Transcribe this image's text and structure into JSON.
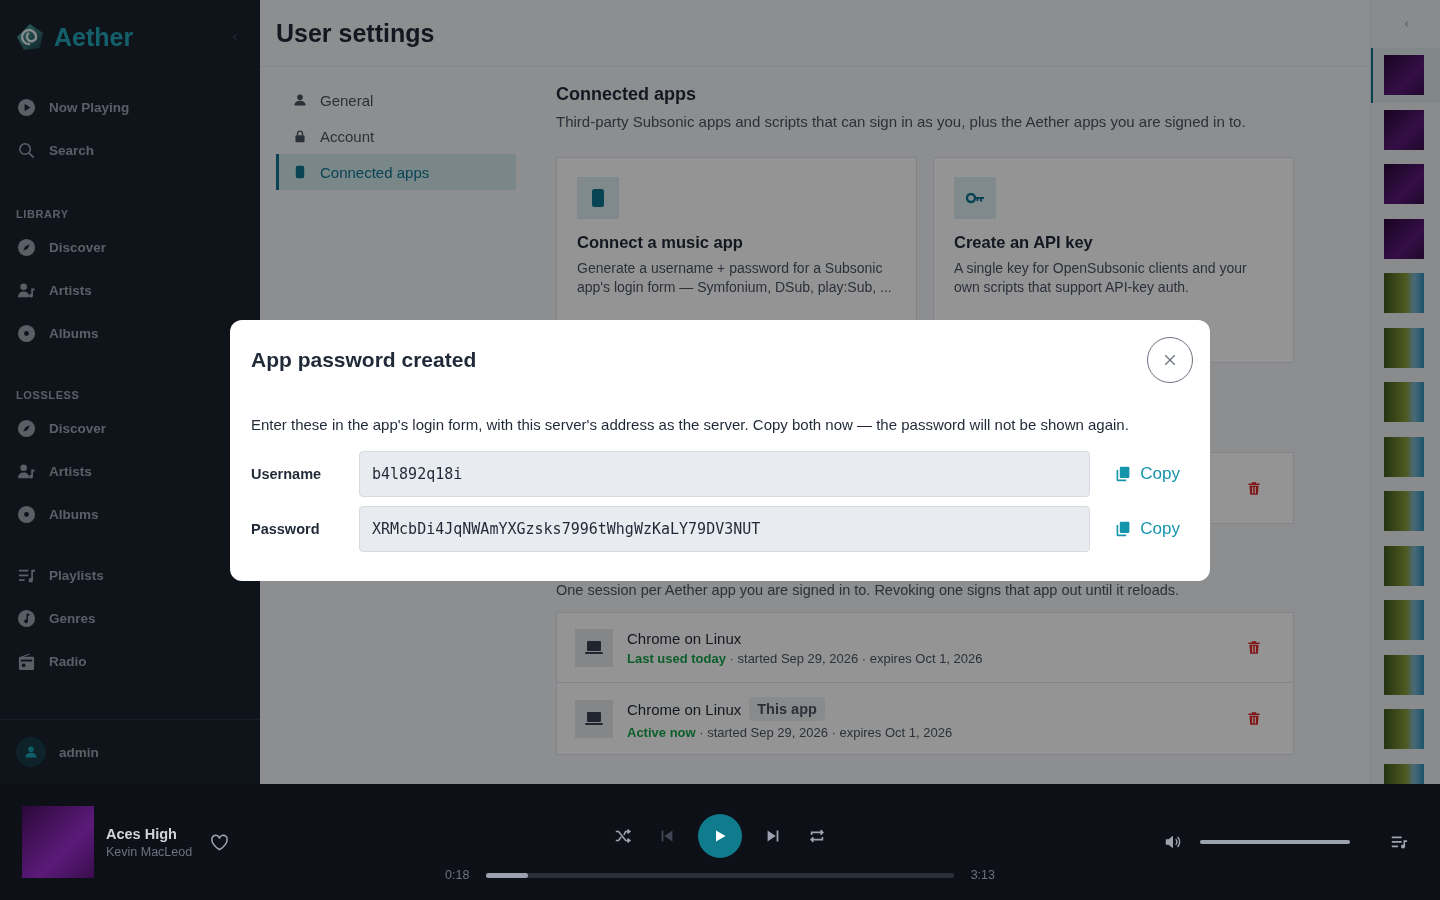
{
  "sidebar": {
    "brand": "Aether",
    "sections": [
      {
        "items": [
          {
            "label": "Now Playing"
          },
          {
            "label": "Search"
          }
        ]
      },
      {
        "heading": "LIBRARY",
        "items": [
          {
            "label": "Discover"
          },
          {
            "label": "Artists"
          },
          {
            "label": "Albums"
          }
        ]
      },
      {
        "heading": "LOSSLESS",
        "items": [
          {
            "label": "Discover"
          },
          {
            "label": "Artists"
          },
          {
            "label": "Albums"
          }
        ]
      },
      {
        "items": [
          {
            "label": "Playlists"
          },
          {
            "label": "Genres"
          },
          {
            "label": "Radio"
          }
        ]
      }
    ],
    "user": "admin"
  },
  "page": {
    "title": "User settings",
    "settings_nav": [
      {
        "label": "General",
        "selected": false
      },
      {
        "label": "Account",
        "selected": false
      },
      {
        "label": "Connected apps",
        "selected": true
      }
    ],
    "heading": "Connected apps",
    "description": "Third-party Subsonic apps and scripts that can sign in as you, plus the Aether apps you are signed in to.",
    "cards": [
      {
        "title": "Connect a music app",
        "description": "Generate a username + password for a Subsonic app's login form — Symfonium, DSub, play:Sub, ..."
      },
      {
        "title": "Create an API key",
        "description": "A single key for OpenSubsonic clients and your own scripts that support API-key auth."
      }
    ],
    "sessions_description": "One session per Aether app you are signed in to. Revoking one signs that app out until it reloads.",
    "sessions": [
      {
        "name": "Chrome on Linux",
        "status": "Last used today",
        "details": "· started Sep 29, 2026 · expires Oct 1, 2026"
      },
      {
        "name": "Chrome on Linux",
        "badge": "This app",
        "status": "Active now",
        "details": "· started Sep 29, 2026 · expires Oct 1, 2026"
      }
    ]
  },
  "queue": [
    {
      "kind": "funk",
      "selected": true
    },
    {
      "kind": "funk",
      "selected": false
    },
    {
      "kind": "funk",
      "selected": false
    },
    {
      "kind": "funk",
      "selected": false
    },
    {
      "kind": "nature",
      "selected": false
    },
    {
      "kind": "nature",
      "selected": false
    },
    {
      "kind": "nature",
      "selected": false
    },
    {
      "kind": "nature",
      "selected": false
    },
    {
      "kind": "nature",
      "selected": false
    },
    {
      "kind": "nature",
      "selected": false
    },
    {
      "kind": "nature",
      "selected": false
    },
    {
      "kind": "nature",
      "selected": false
    },
    {
      "kind": "nature",
      "selected": false
    },
    {
      "kind": "nature",
      "selected": false
    }
  ],
  "dialog": {
    "title": "App password created",
    "description": "Enter these in the app's login form, with this server's address as the server. Copy both now — the password will not be shown again.",
    "fields": [
      {
        "label": "Username",
        "value": "b4l892q18i",
        "action": "Copy"
      },
      {
        "label": "Password",
        "value": "XRMcbDi4JqNWAmYXGzsks7996tWhgWzKaLY79DV3NUT",
        "action": "Copy"
      }
    ]
  },
  "player": {
    "title": "Aces High",
    "artist": "Kevin MacLeod",
    "favorite": false,
    "previous": {
      "disabled": true
    },
    "elapsed": "0:18",
    "duration": "3:13",
    "progress": {
      "level": 0.09
    },
    "volume": {
      "level": 1.0
    }
  }
}
